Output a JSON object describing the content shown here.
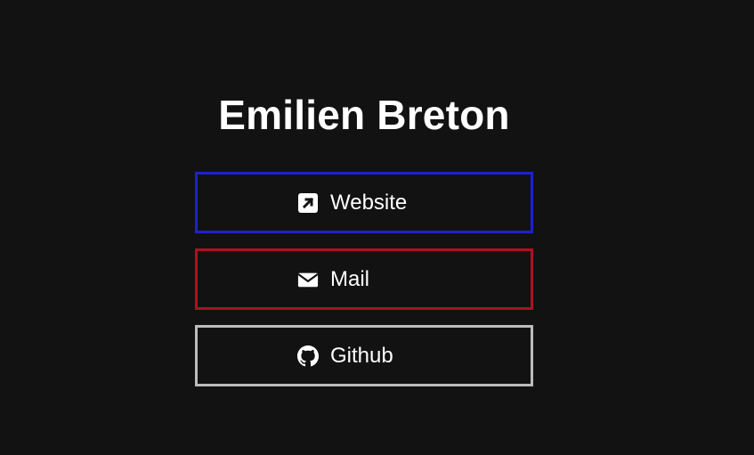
{
  "profile": {
    "name": "Emilien Breton"
  },
  "links": [
    {
      "label": "Website",
      "icon": "external-link-icon",
      "border_color": "#1f22c7"
    },
    {
      "label": "Mail",
      "icon": "envelope-icon",
      "border_color": "#b00f23"
    },
    {
      "label": "Github",
      "icon": "github-icon",
      "border_color": "#bcbcbc"
    }
  ]
}
